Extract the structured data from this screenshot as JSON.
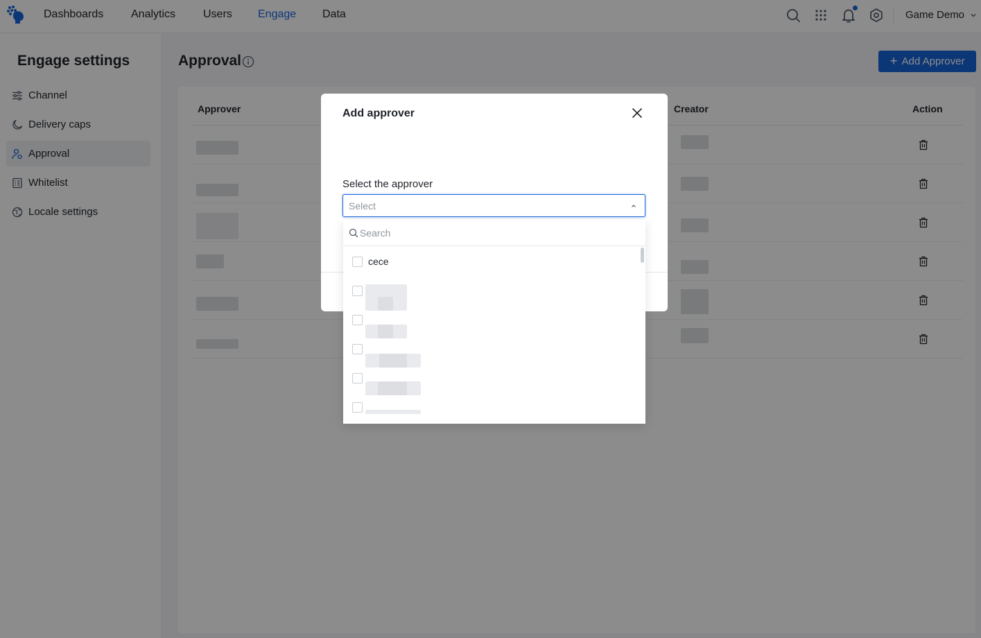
{
  "nav": {
    "items": [
      {
        "label": "Dashboards",
        "active": false
      },
      {
        "label": "Analytics",
        "active": false
      },
      {
        "label": "Users",
        "active": false
      },
      {
        "label": "Engage",
        "active": true
      },
      {
        "label": "Data",
        "active": false
      }
    ],
    "icons": [
      "search-icon",
      "apps-grid-icon",
      "bell-icon",
      "settings-icon"
    ],
    "project_label": "Game Demo",
    "accent_color": "#1664d9"
  },
  "sidebar": {
    "title": "Engage settings",
    "items": [
      {
        "label": "Channel",
        "icon": "sliders-icon",
        "active": false
      },
      {
        "label": "Delivery caps",
        "icon": "moon-icon",
        "active": false
      },
      {
        "label": "Approval",
        "icon": "user-check-icon",
        "active": true
      },
      {
        "label": "Whitelist",
        "icon": "list-icon",
        "active": false
      },
      {
        "label": "Locale settings",
        "icon": "globe-icon",
        "active": false
      }
    ]
  },
  "main": {
    "title": "Approval",
    "add_button_label": "Add Approver",
    "table": {
      "columns": [
        "Approver",
        "Creator",
        "Action"
      ],
      "row_count": 6,
      "cell_content": "redacted"
    }
  },
  "modal": {
    "title": "Add approver",
    "field_label": "Select the approver",
    "select_placeholder": "Select",
    "dropdown": {
      "search_placeholder": "Search",
      "options": [
        {
          "label": "cece",
          "checked": false
        },
        {
          "label": "",
          "redacted": true,
          "checked": false
        },
        {
          "label": "",
          "redacted": true,
          "checked": false
        },
        {
          "label": "",
          "redacted": true,
          "checked": false
        },
        {
          "label": "",
          "redacted": true,
          "checked": false
        },
        {
          "label": "",
          "redacted": true,
          "checked": false
        }
      ]
    }
  }
}
